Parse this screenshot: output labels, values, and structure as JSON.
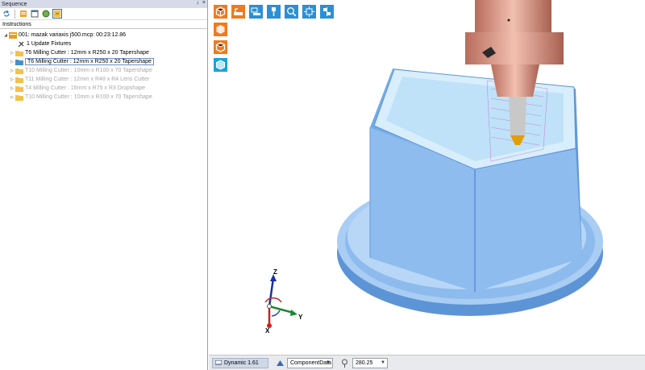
{
  "panel": {
    "title": "Sequence",
    "pin": "↓",
    "close": "×",
    "header": "Instructions"
  },
  "tree": {
    "root": "001: mazak variaxis j500.mcp: 00:23:12.86",
    "update": "1 Update Fixtures",
    "items": [
      {
        "label": "T6 Milling Cutter : 12mm x R250 x 20 Tapershape"
      },
      {
        "label": "T6 Milling Cutter : 12mm x R250 x 20 Tapershape"
      },
      {
        "label": "T10 Milling Cutter : 10mm x R100 x 70 Tapershape"
      },
      {
        "label": "T11 Milling Cutter : 12mm x R48 x R4 Lens Cutter"
      },
      {
        "label": "T4 Milling Cutter : 16mm x R75 x R3 Dropshape"
      },
      {
        "label": "T10 Milling Cutter : 10mm x R100 x 70 Tapershape"
      }
    ]
  },
  "axes": {
    "z": "Z",
    "x": "X",
    "y": "Y"
  },
  "status": {
    "mode": "Dynamic 1.61",
    "component": "ComponentData",
    "value": "280.25"
  }
}
